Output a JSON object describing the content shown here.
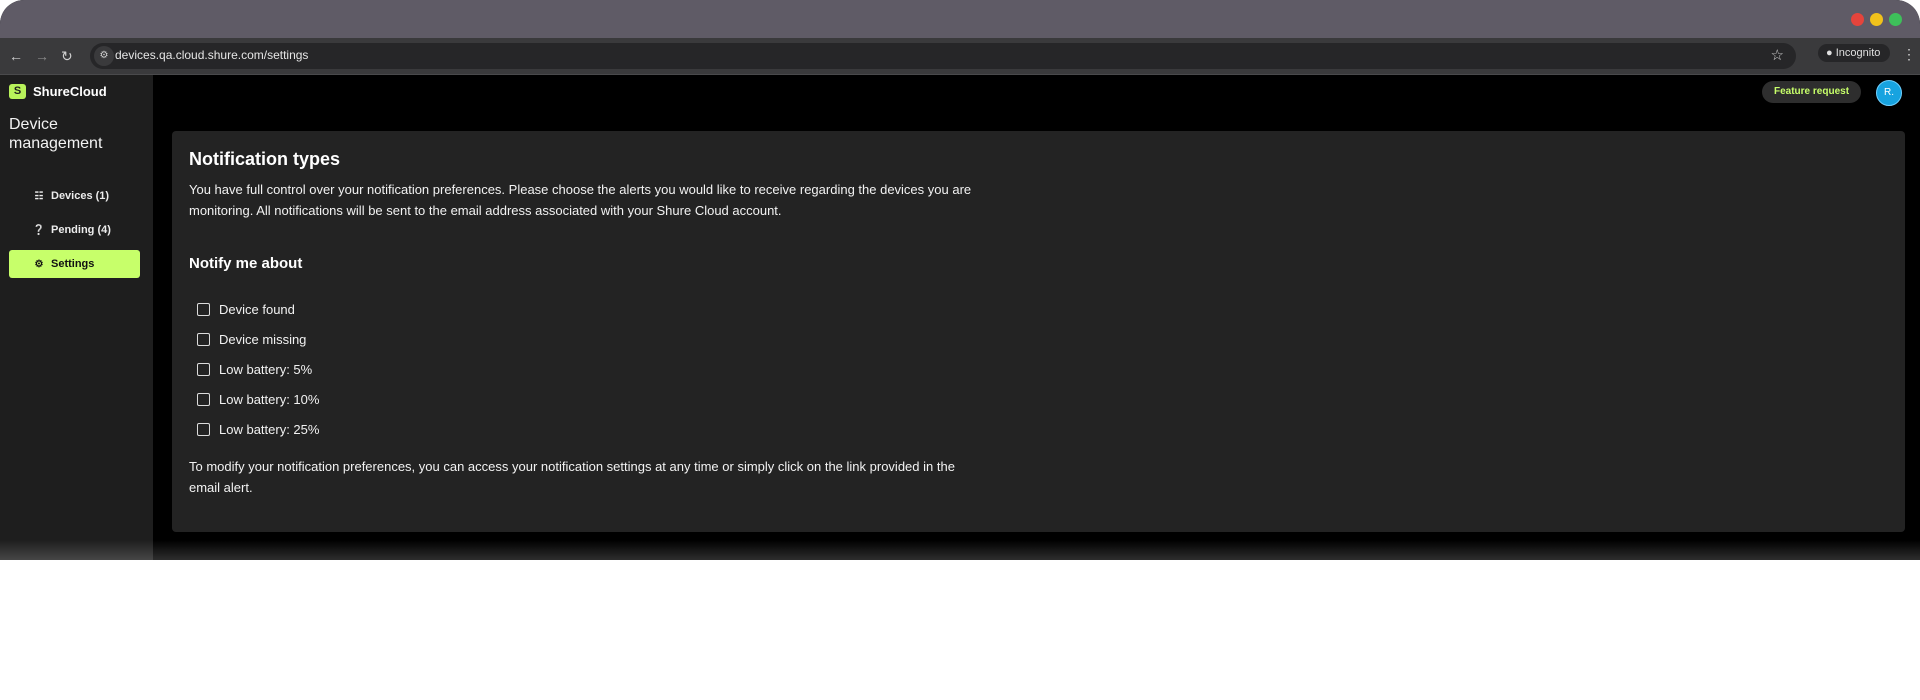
{
  "browser": {
    "url": "devices.qa.cloud.shure.com/settings",
    "incognito_label": "Incognito",
    "traffic_lights": [
      "#e5443c",
      "#f1c21b",
      "#3ec05a"
    ]
  },
  "sidebar": {
    "brand": "ShureCloud",
    "section_title": "Device management",
    "items": [
      {
        "label": "Devices (1)",
        "icon": "devices-icon"
      },
      {
        "label": "Pending (4)",
        "icon": "help-icon"
      },
      {
        "label": "Settings",
        "icon": "gear-icon",
        "active": true
      }
    ]
  },
  "header": {
    "feature_request": "Feature request",
    "avatar_initial": "R."
  },
  "notifications": {
    "title": "Notification types",
    "intro_line1": "You have full control over your notification preferences. Please choose the alerts you would like to receive regarding the devices you are",
    "intro_line2": "monitoring. All notifications will be sent to the email address associated with your Shure Cloud account.",
    "subtitle": "Notify me about",
    "options": [
      {
        "label": "Device found",
        "checked": false
      },
      {
        "label": "Device missing",
        "checked": false
      },
      {
        "label": "Low battery: 5%",
        "checked": false
      },
      {
        "label": "Low battery: 10%",
        "checked": false
      },
      {
        "label": "Low battery: 25%",
        "checked": false
      }
    ],
    "footer_line1": "To modify your notification preferences, you can access your notification settings at any time or simply click on the link provided in the",
    "footer_line2": "email alert."
  },
  "colors": {
    "accent": "#c7ff6a",
    "avatar": "#17a3e0",
    "card": "#232323"
  }
}
